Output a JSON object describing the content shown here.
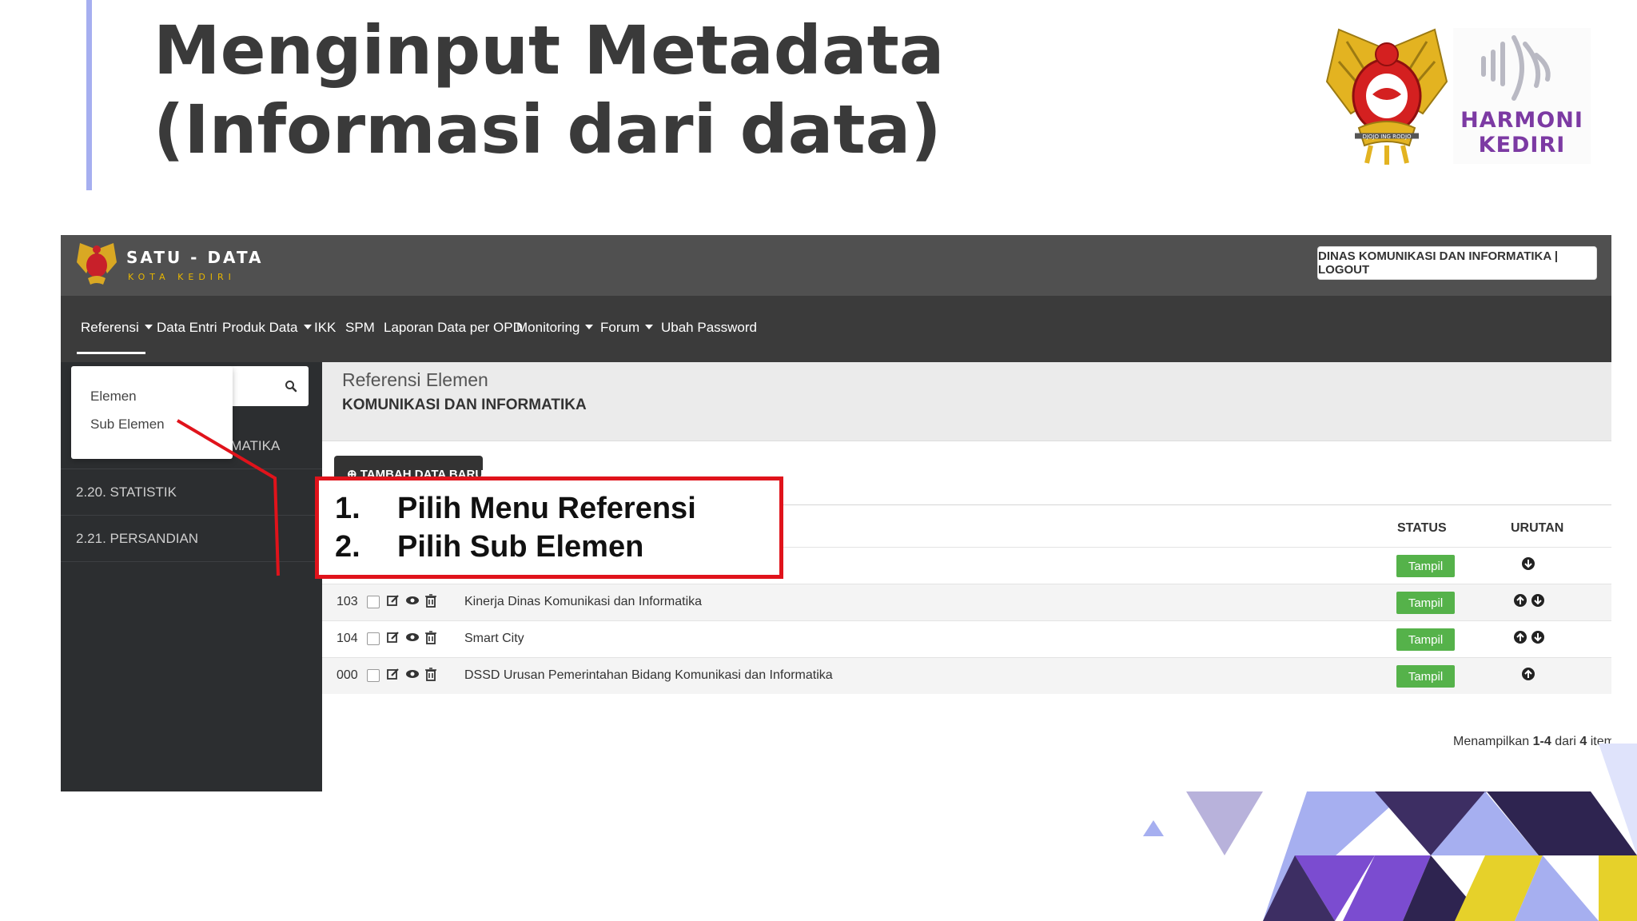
{
  "slide": {
    "title": "Menginput Metadata (Informasi dari data)",
    "logo_text_line1": "HARMONI",
    "logo_text_line2": "KEDIRI",
    "emblem_motto": "DJOJO ING RODJO"
  },
  "app": {
    "brand_name": "SATU - DATA",
    "brand_sub": "KOTA KEDIRI",
    "user_menu": "DINAS KOMUNIKASI DAN INFORMATIKA | LOGOUT",
    "nav": [
      {
        "label": "Referensi"
      },
      {
        "label": "Data Entri"
      },
      {
        "label": "Produk Data"
      },
      {
        "label": "IKK"
      },
      {
        "label": "SPM"
      },
      {
        "label": "Laporan Data per OPD"
      },
      {
        "label": "Monitoring"
      },
      {
        "label": "Forum"
      },
      {
        "label": "Ubah Password"
      }
    ],
    "dropdown": [
      "Elemen",
      "Sub Elemen"
    ],
    "sidebar": {
      "partial_item": "RMATIKA",
      "items": [
        "2.20. STATISTIK",
        "2.21. PERSANDIAN"
      ]
    },
    "content": {
      "title": "Referensi Elemen",
      "subtitle": "KOMUNIKASI DAN INFORMATIKA",
      "add_button": "TAMBAH DATA BARU",
      "columns": {
        "status": "STATUS",
        "urutan": "URUTAN"
      },
      "rows": [
        {
          "id": "",
          "name": "",
          "status": "Tampil"
        },
        {
          "id": "103",
          "name": "Kinerja Dinas Komunikasi dan Informatika",
          "status": "Tampil"
        },
        {
          "id": "104",
          "name": "Smart City",
          "status": "Tampil"
        },
        {
          "id": "000",
          "name": "DSSD Urusan Pemerintahan Bidang Komunikasi dan Informatika",
          "status": "Tampil"
        }
      ],
      "summary_prefix": "Menampilkan",
      "summary_range": "1-4",
      "summary_mid": "dari",
      "summary_total": "4",
      "summary_suffix": "item."
    }
  },
  "callout": {
    "step1_num": "1.",
    "step1_text": "Pilih Menu Referensi",
    "step2_num": "2.",
    "step2_text": "Pilih Sub Elemen"
  },
  "colors": {
    "accent_bar": "#a6aff0",
    "title_text": "#3a3a3a",
    "callout_border": "#e0131b",
    "status_badge": "#55b24a",
    "harmoni_purple": "#7c3aa3"
  }
}
